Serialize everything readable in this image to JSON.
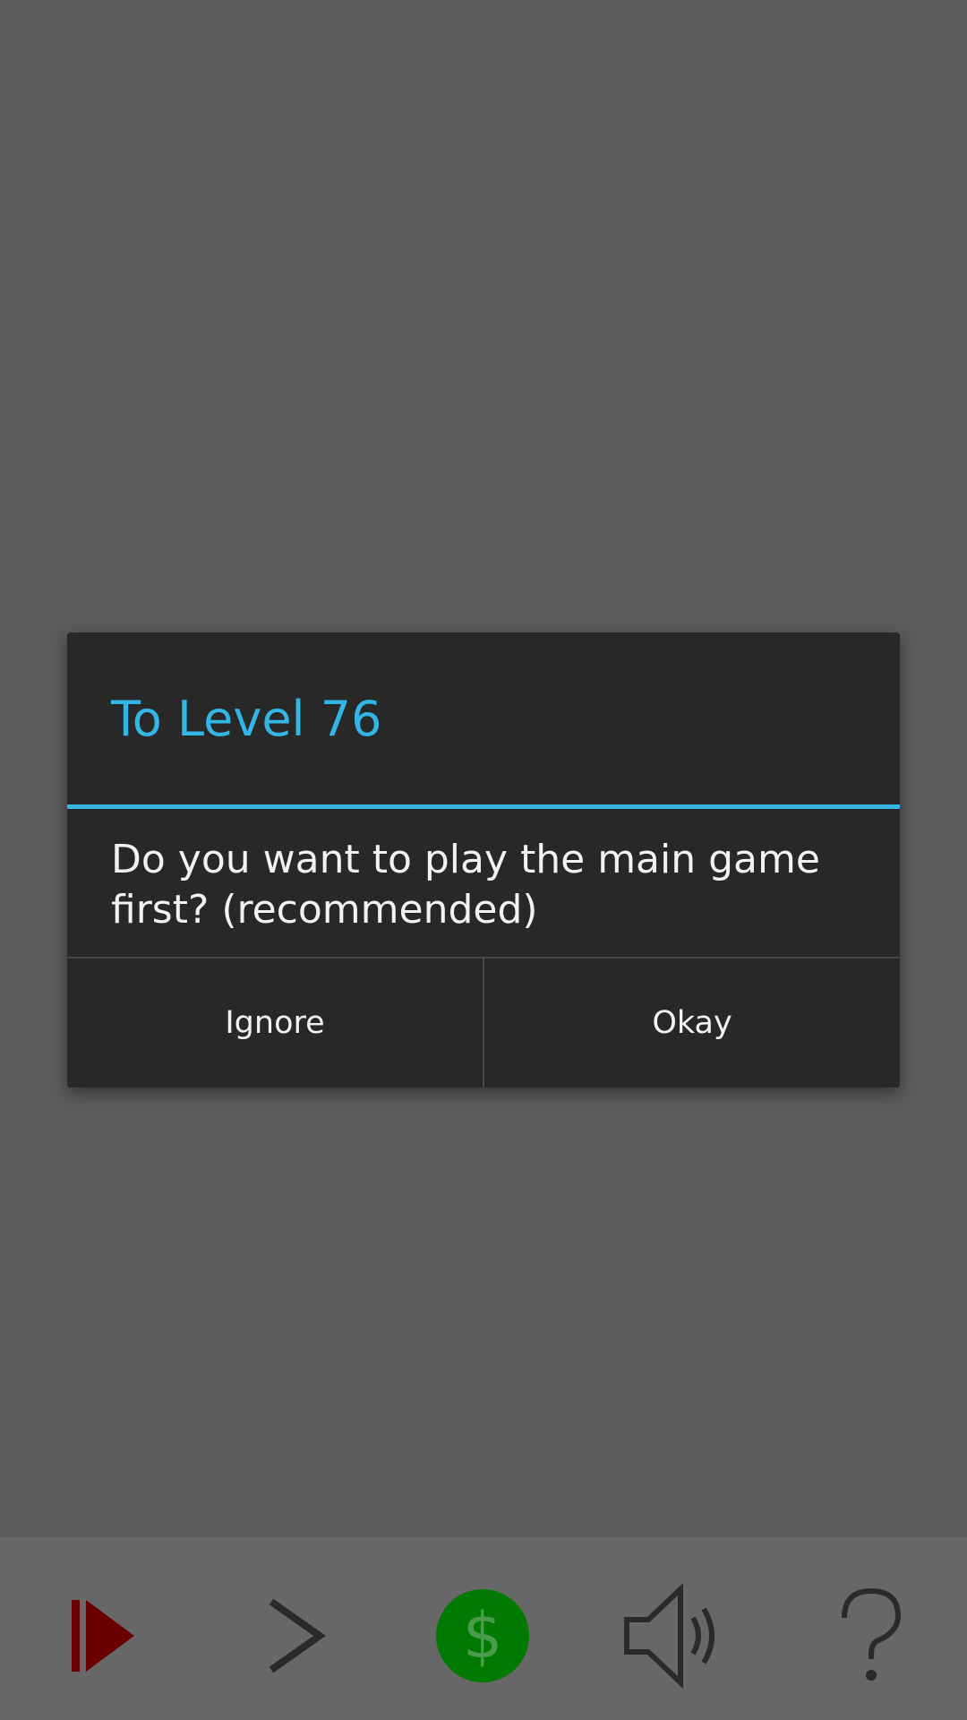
{
  "dialog": {
    "title": "To Level 76",
    "message": "Do you want to play the main game first? (recommended)",
    "ignore_label": "Ignore",
    "okay_label": "Okay",
    "accent_color": "#33b5e5"
  },
  "toolbar": {
    "items": [
      {
        "icon": "skip-play-icon",
        "color": "#6b0000"
      },
      {
        "icon": "chevron-right-icon",
        "color": "#2a2a2a"
      },
      {
        "icon": "dollar-coin-icon",
        "color": "#007a00",
        "glyph": "$"
      },
      {
        "icon": "speaker-icon",
        "color": "#2a2a2a"
      },
      {
        "icon": "help-icon",
        "color": "#2a2a2a",
        "glyph": "?"
      }
    ]
  },
  "colors": {
    "background": "#5b5c5e",
    "toolbar": "#676767",
    "dialog": "#282828"
  }
}
